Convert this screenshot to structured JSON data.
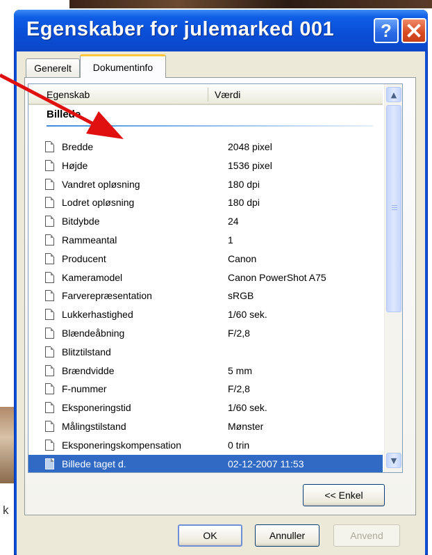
{
  "window": {
    "title": "Egenskaber for julemarked 001",
    "help_glyph": "?",
    "close_icon": "close-icon"
  },
  "tabs": [
    {
      "label": "Generelt"
    },
    {
      "label": "Dokumentinfo"
    }
  ],
  "list": {
    "columns": {
      "property": "Egenskab",
      "value": "Værdi"
    },
    "group": "Billede",
    "rows": [
      {
        "name": "Bredde",
        "value": "2048 pixel"
      },
      {
        "name": "Højde",
        "value": "1536 pixel"
      },
      {
        "name": "Vandret opløsning",
        "value": "180 dpi"
      },
      {
        "name": "Lodret opløsning",
        "value": "180 dpi"
      },
      {
        "name": "Bitdybde",
        "value": "24"
      },
      {
        "name": "Rammeantal",
        "value": "1"
      },
      {
        "name": "Producent",
        "value": "Canon"
      },
      {
        "name": "Kameramodel",
        "value": "Canon PowerShot A75"
      },
      {
        "name": "Farverepræsentation",
        "value": "sRGB"
      },
      {
        "name": "Lukkerhastighed",
        "value": "1/60 sek."
      },
      {
        "name": "Blændeåbning",
        "value": "F/2,8"
      },
      {
        "name": "Blitztilstand",
        "value": ""
      },
      {
        "name": "Brændvidde",
        "value": "5 mm"
      },
      {
        "name": "F-nummer",
        "value": "F/2,8"
      },
      {
        "name": "Eksponeringstid",
        "value": "1/60 sek."
      },
      {
        "name": "Målingstilstand",
        "value": "Mønster"
      },
      {
        "name": "Eksponeringskompensation",
        "value": "0 trin"
      },
      {
        "name": "Billede taget d.",
        "value": "02-12-2007 11:53",
        "selected": true
      }
    ]
  },
  "buttons": {
    "simple": "<< Enkel",
    "ok": "OK",
    "cancel": "Annuller",
    "apply": "Anvend"
  },
  "background": {
    "left_char": "k"
  },
  "colors": {
    "titlebar": "#0a4fd8",
    "selection": "#316ac5",
    "annotation_arrow": "#e01010"
  }
}
